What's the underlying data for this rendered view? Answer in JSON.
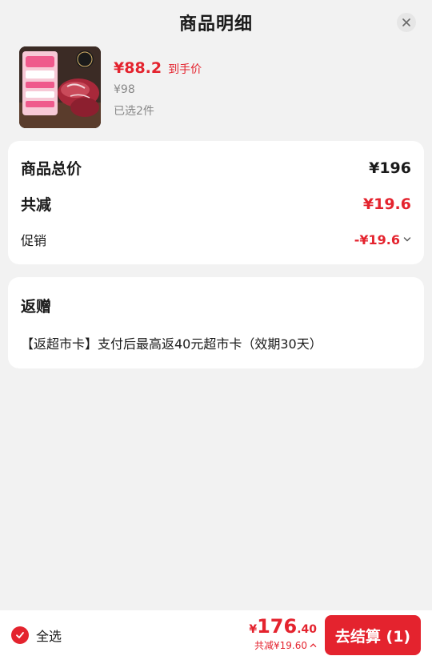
{
  "header": {
    "title": "商品明细",
    "close_icon": "close-icon"
  },
  "product": {
    "price": "¥88.2",
    "price_tag": "到手价",
    "original_price": "¥98",
    "selected_count": "已选2件"
  },
  "summary": {
    "total_label": "商品总价",
    "total_value": "¥196",
    "reduce_label": "共减",
    "reduce_value": "¥19.6",
    "promo_label": "促销",
    "promo_value": "-¥19.6"
  },
  "gift": {
    "title": "返赠",
    "text": "【返超市卡】支付后最高返40元超市卡（效期30天）"
  },
  "footer": {
    "select_all": "全选",
    "total_yen": "¥",
    "total_int": "176",
    "total_dec": ".40",
    "total_reduce": "共减¥19.60",
    "checkout": "去结算 (1)"
  },
  "colors": {
    "accent": "#e4232e",
    "background": "#f2f2f2"
  }
}
